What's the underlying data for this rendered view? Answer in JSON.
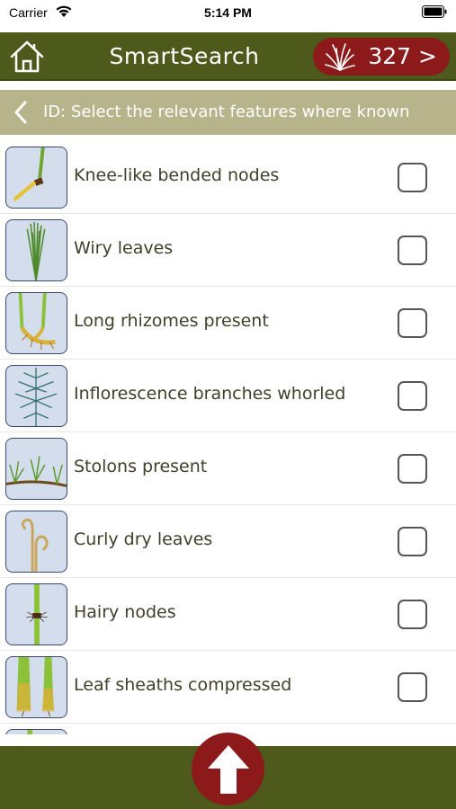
{
  "status_bar": {
    "carrier": "Carrier",
    "time": "5:14 PM"
  },
  "header": {
    "title": "SmartSearch",
    "results_count": "327 >",
    "home_icon": "home-icon",
    "result_icon": "grass-icon"
  },
  "sub_header": {
    "title": "ID: Select the relevant features where known",
    "back_icon": "chevron-left-icon"
  },
  "features": [
    {
      "label": "Knee-like bended nodes",
      "checked": false,
      "thumb": "knee-node"
    },
    {
      "label": "Wiry leaves",
      "checked": false,
      "thumb": "wiry-leaves"
    },
    {
      "label": "Long rhizomes present",
      "checked": false,
      "thumb": "rhizomes"
    },
    {
      "label": "Inflorescence branches whorled",
      "checked": false,
      "thumb": "whorled"
    },
    {
      "label": "Stolons present",
      "checked": false,
      "thumb": "stolons"
    },
    {
      "label": "Curly dry leaves",
      "checked": false,
      "thumb": "curly"
    },
    {
      "label": "Hairy nodes",
      "checked": false,
      "thumb": "hairy-nodes"
    },
    {
      "label": "Leaf sheaths compressed",
      "checked": false,
      "thumb": "sheaths"
    },
    {
      "label": "",
      "checked": false,
      "thumb": "partial"
    }
  ],
  "footer": {
    "scroll_top_icon": "arrow-up-icon"
  },
  "colors": {
    "header_bg": "#4d5a1c",
    "accent_red": "#8c1a1a",
    "sub_header_bg": "#b7b38b",
    "thumb_bg": "#d3ddec"
  }
}
